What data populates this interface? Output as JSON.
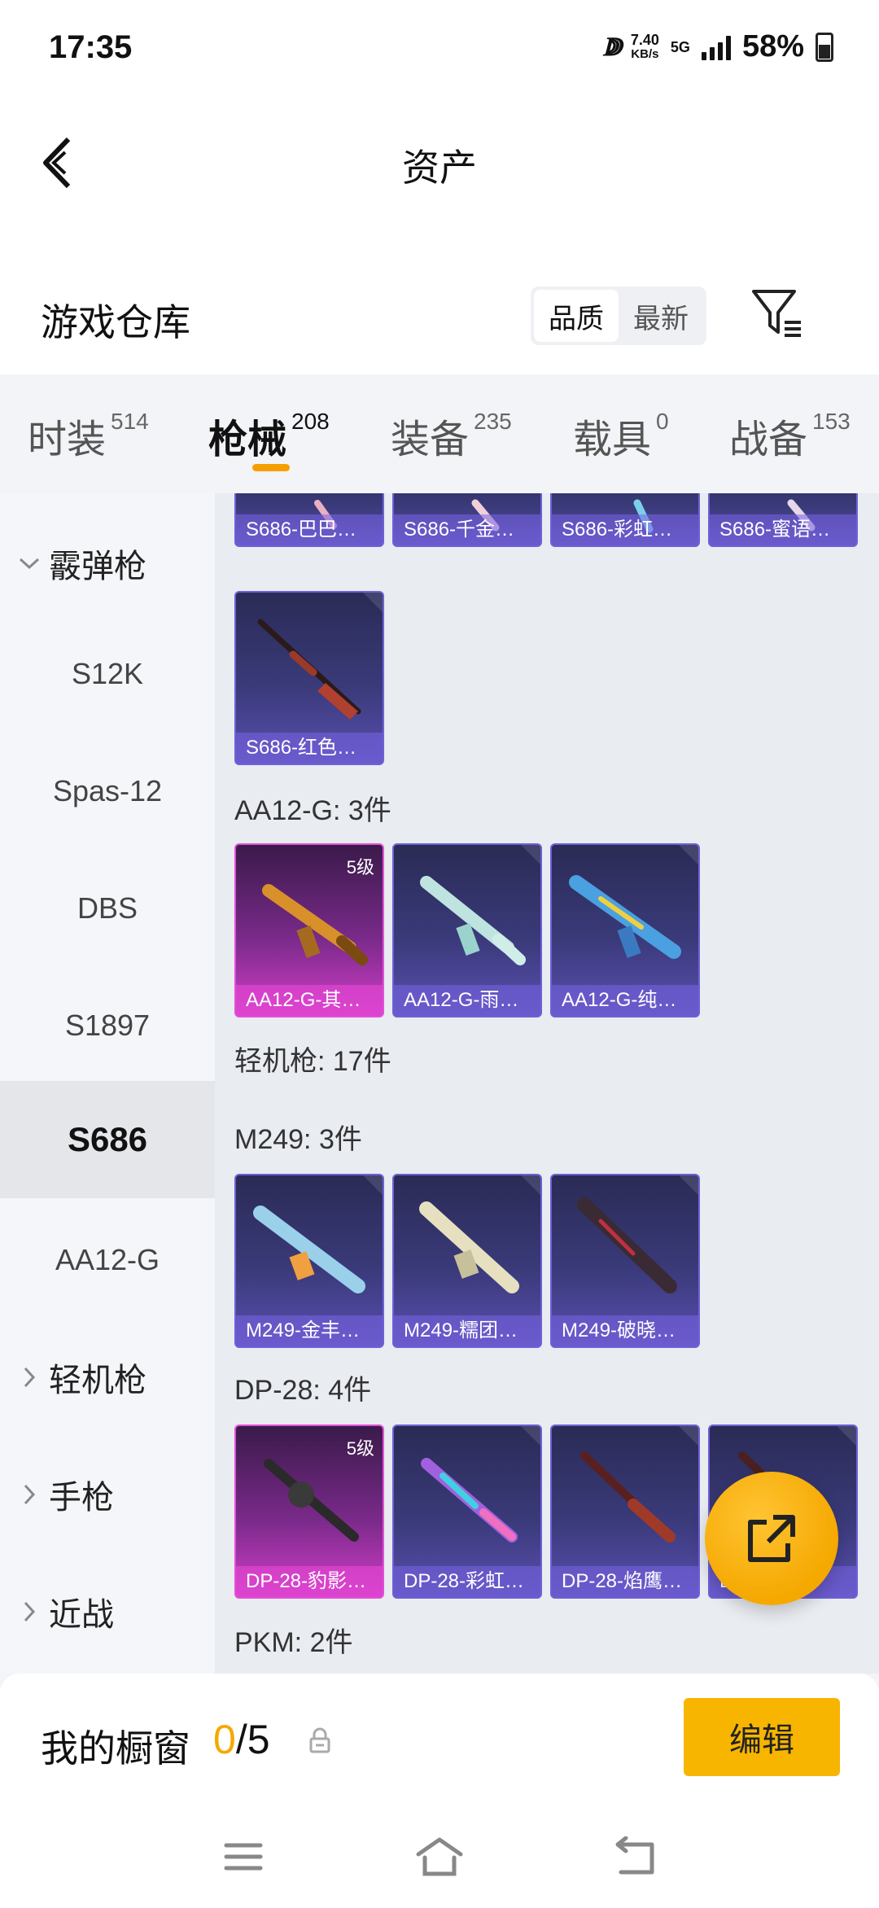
{
  "status_bar": {
    "time": "17:35",
    "network_speed_value": "7.40",
    "network_speed_unit": "KB/s",
    "network_type": "5G",
    "battery_pct": "58%"
  },
  "nav": {
    "title": "资产"
  },
  "header": {
    "title": "游戏仓库",
    "sort_options": [
      "品质",
      "最新"
    ],
    "sort_active": "品质"
  },
  "tabs": [
    {
      "label": "时装",
      "count": "514"
    },
    {
      "label": "枪械",
      "count": "208"
    },
    {
      "label": "装备",
      "count": "235"
    },
    {
      "label": "载具",
      "count": "0"
    },
    {
      "label": "战备",
      "count": "153"
    }
  ],
  "active_tab": "枪械",
  "sidebar": {
    "group_open": "霰弹枪",
    "items": [
      "S12K",
      "Spas-12",
      "DBS",
      "S1897",
      "S686",
      "AA12-G"
    ],
    "active_item": "S686",
    "groups_closed": [
      "轻机枪",
      "手枪",
      "近战"
    ]
  },
  "content": {
    "top_cards": [
      "S686-巴巴…",
      "S686-千金…",
      "S686-彩虹…",
      "S686-蜜语…"
    ],
    "s686_extra": "S686-红色…",
    "aa12_heading": "AA12-G: 3件",
    "aa12_cards": [
      {
        "label": "AA12-G-其…",
        "level": "5级",
        "gold": true
      },
      {
        "label": "AA12-G-雨…",
        "gold": false
      },
      {
        "label": "AA12-G-纯…",
        "gold": false
      }
    ],
    "lmg_heading": "轻机枪: 17件",
    "m249_heading": "M249: 3件",
    "m249_cards": [
      "M249-金丰…",
      "M249-糯团…",
      "M249-破晓…"
    ],
    "dp28_heading": "DP-28: 4件",
    "dp28_cards": [
      {
        "label": "DP-28-豹影…",
        "level": "5级",
        "gold": true
      },
      {
        "label": "DP-28-彩虹…",
        "gold": false
      },
      {
        "label": "DP-28-焰鹰…",
        "gold": false
      },
      {
        "label": "DP-28-…",
        "gold": false
      }
    ],
    "pkm_heading": "PKM: 2件"
  },
  "showcase": {
    "title": "我的橱窗",
    "current": "0",
    "total": "/5",
    "edit_label": "编辑"
  },
  "colors": {
    "accent": "#f5a800",
    "card_purple": "#3a3a7a",
    "card_gold": "#d23ec8"
  }
}
